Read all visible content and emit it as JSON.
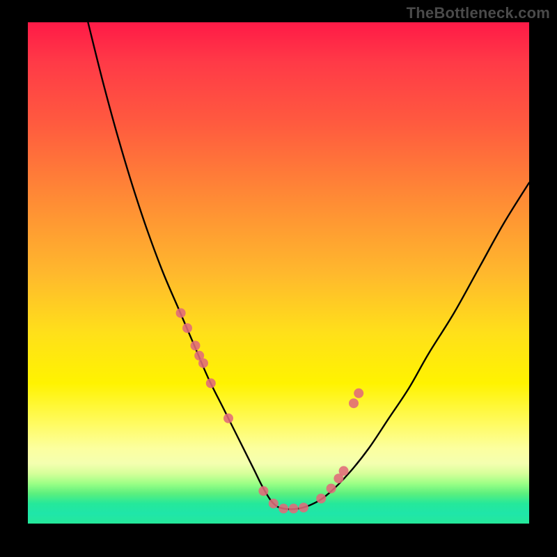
{
  "watermark": "TheBottleneck.com",
  "chart_data": {
    "type": "line",
    "title": "",
    "xlabel": "",
    "ylabel": "",
    "xlim": [
      0,
      100
    ],
    "ylim": [
      0,
      100
    ],
    "series": [
      {
        "name": "curve",
        "x": [
          12,
          15,
          18,
          21,
          24,
          27,
          30,
          33,
          36,
          39,
          42,
          45,
          47,
          49,
          51,
          54,
          57,
          60,
          64,
          68,
          72,
          76,
          80,
          85,
          90,
          95,
          100
        ],
        "y": [
          100,
          88,
          77,
          67,
          58,
          50,
          43,
          36,
          29,
          23,
          17,
          11,
          7,
          4,
          3,
          3,
          4,
          6,
          10,
          15,
          21,
          27,
          34,
          42,
          51,
          60,
          68
        ]
      }
    ],
    "markers": {
      "name": "highlight-points",
      "x": [
        30.5,
        31.8,
        33.4,
        34.2,
        35.0,
        36.5,
        40.0,
        47.0,
        49.0,
        51.0,
        53.0,
        55.0,
        58.5,
        60.5,
        62.0,
        63.0,
        65.0,
        66.0
      ],
      "y": [
        42.0,
        39.0,
        35.5,
        33.5,
        32.0,
        28.0,
        21.0,
        6.5,
        4.0,
        3.0,
        3.0,
        3.2,
        5.0,
        7.0,
        9.0,
        10.5,
        24.0,
        26.0
      ]
    },
    "gradient_bands": [
      {
        "color": "#ff1a47",
        "y": 100
      },
      {
        "color": "#ff8a35",
        "y": 65
      },
      {
        "color": "#ffe01a",
        "y": 38
      },
      {
        "color": "#fffb60",
        "y": 20
      },
      {
        "color": "#f4ffb0",
        "y": 12
      },
      {
        "color": "#9cff86",
        "y": 8
      },
      {
        "color": "#25e89a",
        "y": 2
      }
    ]
  }
}
